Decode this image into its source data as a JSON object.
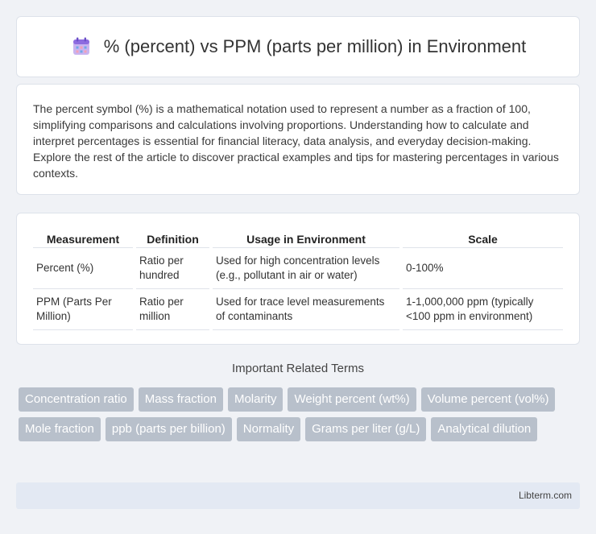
{
  "header": {
    "title": "% (percent) vs PPM (parts per million) in Environment",
    "icon": "calendar-icon"
  },
  "intro": {
    "text": "The percent symbol (%) is a mathematical notation used to represent a number as a fraction of 100, simplifying comparisons and calculations involving proportions. Understanding how to calculate and interpret percentages is essential for financial literacy, data analysis, and everyday decision-making. Explore the rest of the article to discover practical examples and tips for mastering percentages in various contexts."
  },
  "table": {
    "headers": [
      "Measurement",
      "Definition",
      "Usage in Environment",
      "Scale"
    ],
    "rows": [
      [
        "Percent (%)",
        "Ratio per hundred",
        "Used for high concentration levels (e.g., pollutant in air or water)",
        "0-100%"
      ],
      [
        "PPM (Parts Per Million)",
        "Ratio per million",
        "Used for trace level measurements of contaminants",
        "1-1,000,000 ppm (typically <100 ppm in environment)"
      ]
    ]
  },
  "related": {
    "heading": "Important Related Terms",
    "tags": [
      "Concentration ratio",
      "Mass fraction",
      "Molarity",
      "Weight percent (wt%)",
      "Volume percent (vol%)",
      "Mole fraction",
      "ppb (parts per billion)",
      "Normality",
      "Grams per liter (g/L)",
      "Analytical dilution"
    ]
  },
  "footer": {
    "text": "Libterm.com"
  },
  "colors": {
    "background": "#f0f2f6",
    "tag_bg": "#b8c0cb",
    "footer_bg": "#e3e9f3"
  }
}
